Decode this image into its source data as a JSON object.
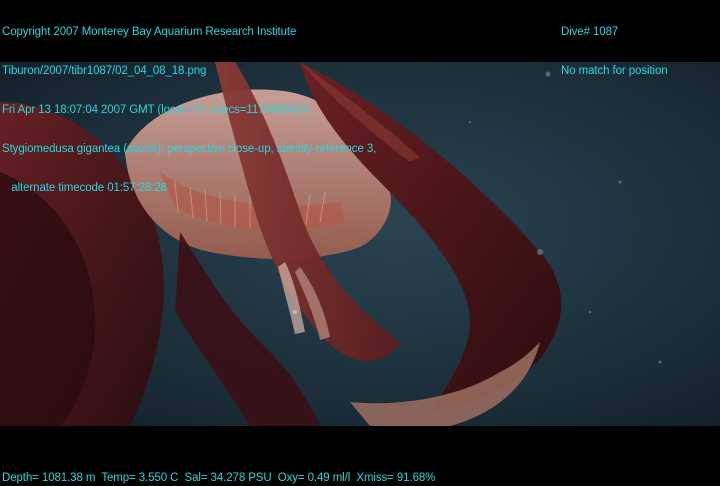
{
  "overlay": {
    "top_left": [
      "Copyright 2007 Monterey Bay Aquarium Research Institute",
      "Tiburon/2007/tibr1087/02_04_08_18.png",
      "Fri Apr 13 18:07:04 2007 GMT (local +7)  esecs=1176480424",
      "Stygiomedusa gigantea (sbush): perspective close-up, identity-reference 3,",
      "   alternate timecode 01:57:28:28"
    ],
    "top_right": [
      "Dive# 1087",
      "No match for position"
    ],
    "bottom": "Depth= 1081.38 m  Temp= 3.550 C  Sal= 34.278 PSU  Oxy= 0.49 ml/l  Xmiss= 91.68%"
  },
  "colors": {
    "overlay_text": "#29d6e0",
    "water": "#1c2f3a",
    "jelly_arm": "#5a1a1e",
    "bell": "#c98a86"
  }
}
